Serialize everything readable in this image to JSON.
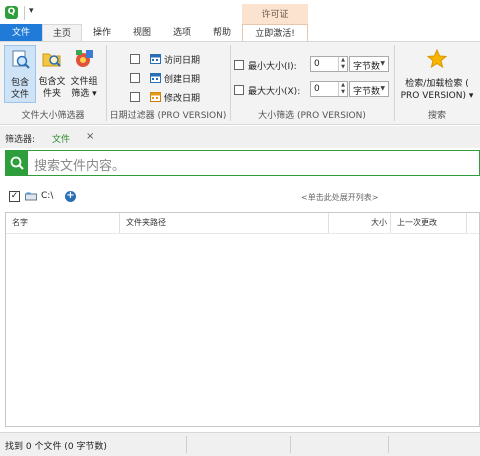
{
  "app": {
    "logo_letter": "Q",
    "quick_access": "▾"
  },
  "ribbon_tabs": {
    "file": "文件",
    "home": "主页",
    "operations": "操作",
    "view": "视图",
    "options": "选项",
    "help": "帮助",
    "license_group": "许可证",
    "activate": "立即激活!"
  },
  "file_size_filter_group": {
    "buttons": [
      {
        "label1": "包含",
        "label2": "文件",
        "icon": "search-file-icon",
        "selected": true
      },
      {
        "label1": "包含文",
        "label2": "件夹",
        "icon": "folder-search-icon",
        "selected": false
      },
      {
        "label1": "文件组",
        "label2": "筛选 ▾",
        "icon": "file-group-icon",
        "selected": false
      }
    ],
    "label": "文件大小筛选器"
  },
  "date_filter_group": {
    "items": [
      "访问日期",
      "创建日期",
      "修改日期"
    ],
    "label": "日期过滤器 (PRO VERSION)"
  },
  "size_filter_group": {
    "min_label": "最小大小(I):",
    "max_label": "最大大小(X):",
    "min_value": "0",
    "max_value": "0",
    "min_unit": "字节数",
    "max_unit": "字节数",
    "label": "大小筛选 (PRO VERSION)"
  },
  "search_group": {
    "button_line1": "检索/加载检索 (",
    "button_line2": "PRO VERSION) ▾",
    "label": "搜索"
  },
  "filter_bar": {
    "label": "筛选器:",
    "active_tab": "文件",
    "close": "×"
  },
  "search": {
    "placeholder": "搜索文件内容。"
  },
  "path_bar": {
    "checked": "✓",
    "drive": "C:\\",
    "add": "+",
    "expand_hint": "<单击此处展开列表>"
  },
  "results": {
    "columns": [
      "名字",
      "文件夹路径",
      "大小",
      "上一次更改"
    ]
  },
  "status": {
    "text": "找到 0 个文件 (0 字节数)"
  },
  "colors": {
    "accent": "#1f7ad8",
    "brand_green": "#2e9d3b",
    "license_bg": "#fbe3d0",
    "star": "#f7b500"
  }
}
